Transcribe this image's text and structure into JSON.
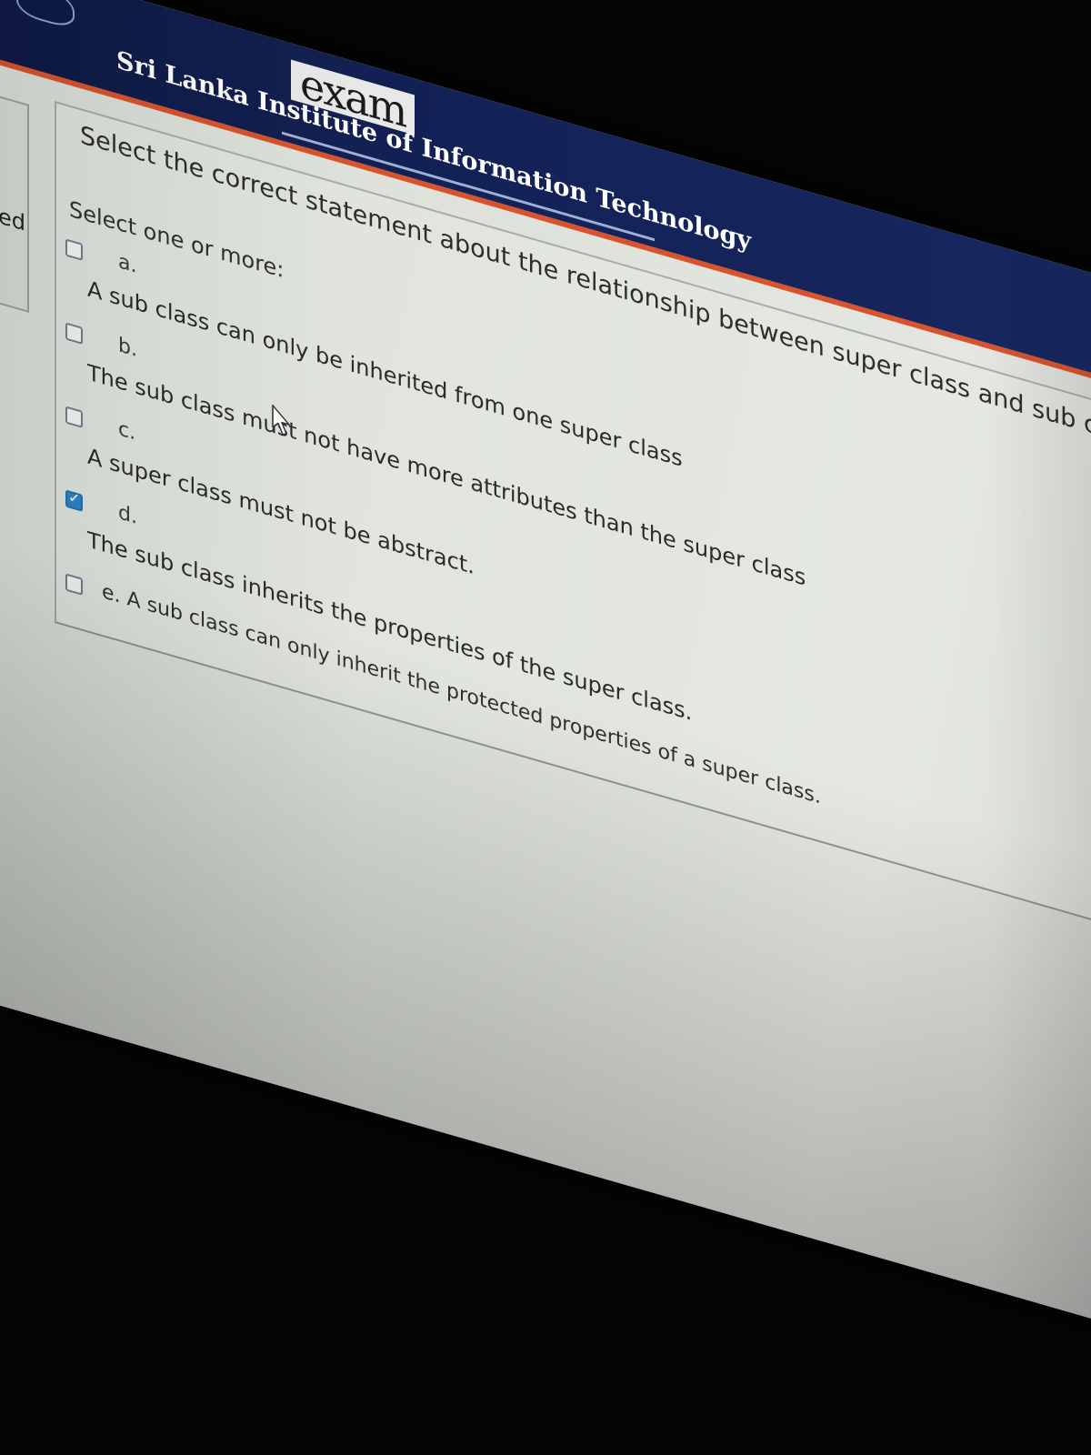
{
  "header": {
    "app_title": "exam",
    "organization": "Sri Lanka Institute of Information Technology"
  },
  "sidebar": {
    "tab_label": "ed"
  },
  "question": {
    "text": "Select the correct statement about the relationship between super class and sub classes",
    "prompt": "Select one or more:",
    "options": [
      {
        "letter": "a.",
        "text": "A sub class can only be inherited from one super class",
        "checked": false
      },
      {
        "letter": "b.",
        "text": "The sub class must not have more attributes than the super class",
        "checked": false
      },
      {
        "letter": "c.",
        "text": "A super class must not be abstract.",
        "checked": false
      },
      {
        "letter": "d.",
        "text": "The sub class inherits the properties of the super class.",
        "checked": true
      },
      {
        "letter": "",
        "text": "e. A sub class can only inherit the protected properties of a super class.",
        "checked": false
      }
    ]
  },
  "colors": {
    "header_bg": "#132257",
    "header_accent": "#d8532b",
    "checkbox_checked": "#2f82c4",
    "text": "#2a2a2a"
  },
  "icons": {
    "cursor": "mouse-pointer-icon",
    "check": "checkmark-icon"
  }
}
